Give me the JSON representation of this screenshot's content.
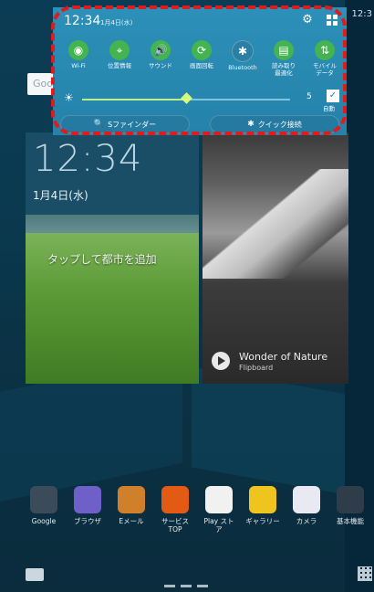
{
  "status_right": "12:3",
  "search": {
    "label": "Goo"
  },
  "clock_widget": {
    "time": "12:34",
    "date": "1月4日(水)",
    "tap_city": "タップして都市を追加"
  },
  "photo_widget": {
    "title": "Wonder of Nature",
    "subtitle": "Flipboard"
  },
  "quick_panel": {
    "time": "12:34",
    "date": "1月4日(水)",
    "toggles": [
      {
        "label": "Wi-Fi",
        "icon": "wifi-icon",
        "state": "on",
        "glyph": "◉"
      },
      {
        "label": "位置情報",
        "icon": "location-icon",
        "state": "on",
        "glyph": "⌖"
      },
      {
        "label": "サウンド",
        "icon": "sound-icon",
        "state": "on",
        "glyph": "🔊"
      },
      {
        "label": "画面回転",
        "icon": "rotate-icon",
        "state": "on",
        "glyph": "⟳"
      },
      {
        "label": "Bluetooth",
        "icon": "bluetooth-icon",
        "state": "off",
        "glyph": "✱"
      },
      {
        "label": "読み取り\n最適化",
        "icon": "reading-mode-icon",
        "state": "on",
        "glyph": "▤"
      },
      {
        "label": "モバイル\nデータ",
        "icon": "mobile-data-icon",
        "state": "on",
        "glyph": "⇅"
      }
    ],
    "brightness": {
      "value": "5",
      "fill": 0.5,
      "auto_label": "自動"
    },
    "s_finder": "Sファインダー",
    "quick_connect": "クイック接続"
  },
  "dock": [
    {
      "label": "Google",
      "color": "#3b4b5a"
    },
    {
      "label": "ブラウザ",
      "color": "#6e60c8"
    },
    {
      "label": "Eメール",
      "color": "#d0802a"
    },
    {
      "label": "サービス\nTOP",
      "color": "#e35a15"
    },
    {
      "label": "Play スト\nア",
      "color": "#f1f1f1"
    },
    {
      "label": "ギャラリー",
      "color": "#f0c41f"
    },
    {
      "label": "カメラ",
      "color": "#e9e9f3"
    },
    {
      "label": "基本機能",
      "color": "#2f3d4a"
    }
  ],
  "colors": {
    "panel": "#2c90b8",
    "toggle_on": "#43b44f",
    "highlight": "#e01b1b"
  }
}
